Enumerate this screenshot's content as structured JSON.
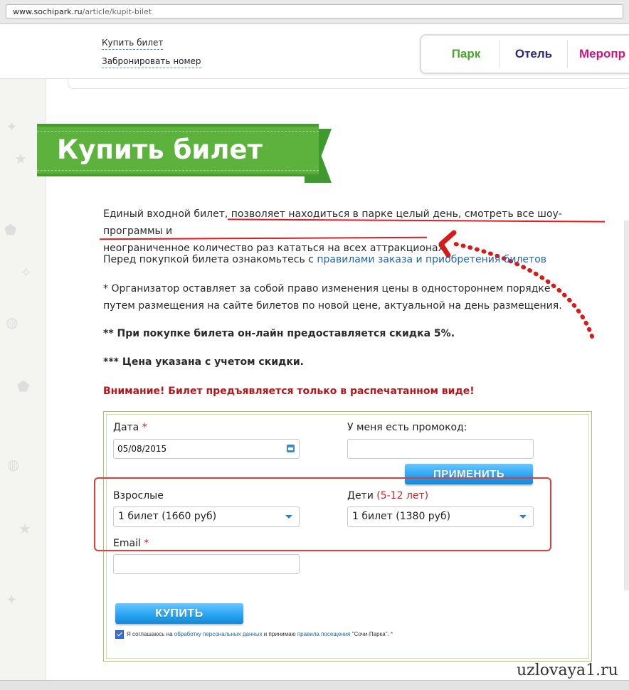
{
  "browser": {
    "url_host": "www.sochipark.ru",
    "url_path": "/article/kupit-bilet"
  },
  "header": {
    "links": [
      "Купить билет",
      "Забронировать номер"
    ],
    "nav": [
      {
        "label": "Парк",
        "color": "#4aa52e"
      },
      {
        "label": "Отель",
        "color": "#2b2a7a"
      },
      {
        "label": "Меропр",
        "color": "#d1147a"
      }
    ]
  },
  "page": {
    "title": "Купить билет",
    "intro_plain": "Единый входной билет, ",
    "intro_highlight_1": "позволяет находиться в парке целый день, смотреть все шоу-программы и",
    "intro_highlight_2": "неограниченное количество раз кататься на всех аттракционах",
    "intro_end": ".",
    "rules_prefix": "Перед покупкой билета ознакомьтесь с ",
    "rules_link": "правилами заказа и приобретения билетов",
    "note1": "* Организатор оставляет за собой право изменения цены в одностороннем порядке путем размещения на сайте билетов по новой цене, актуальной на день размещения.",
    "note2": "** При покупке билета он-лайн предоставляется скидка 5%.",
    "note3": "*** Цена указана с учетом скидки.",
    "warning": "Внимание! Билет предъявляется только в распечатанном виде!"
  },
  "form": {
    "date_label": "Дата",
    "date_value": "05/08/2015",
    "promo_label": "У меня есть промокод:",
    "promo_value": "",
    "apply_button": "ПРИМЕНИТЬ",
    "adults_label": "Взрослые",
    "adults_value": "1 билет (1660 руб)",
    "kids_label": "Дети",
    "kids_age": "(5-12 лет)",
    "kids_value": "1 билет (1380 руб)",
    "email_label": "Email",
    "email_value": "",
    "required_mark": "*",
    "buy_button": "КУПИТЬ",
    "agree_prefix": "Я соглашаюсь на ",
    "agree_link1": "обработку персональных данных",
    "agree_mid": " и принимаю ",
    "agree_link2": "правила посещения",
    "agree_suffix": " \"Сочи-Парка\".",
    "agree_checked": true
  },
  "watermark": "uzlovaya1.ru",
  "colors": {
    "green_ribbon": "#5db23d",
    "warning_red": "#b4171c",
    "link_blue": "#2265a8",
    "annotation_red": "#e21b23"
  }
}
